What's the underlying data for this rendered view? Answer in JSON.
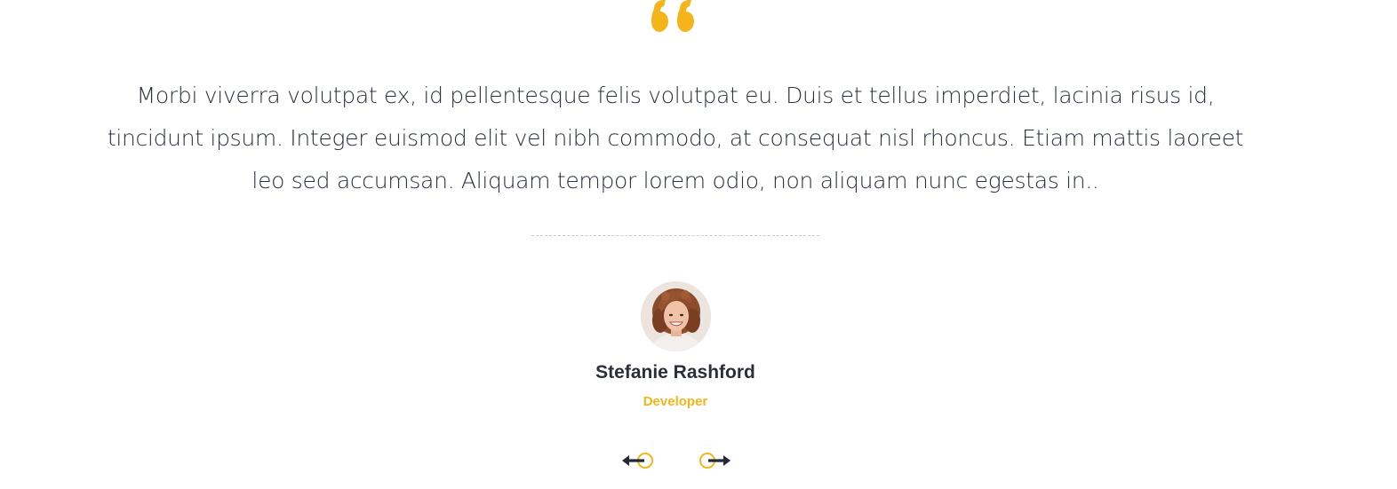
{
  "testimonial": {
    "quote_icon": "quote-open-icon",
    "quote_text": "Morbi viverra volutpat ex, id pellentesque felis volutpat eu. Duis et tellus imperdiet, lacinia risus id, tincidunt ipsum. Integer euismod elit vel nibh commodo, at consequat nisl rhoncus. Etiam mattis laoreet leo sed accumsan. Aliquam tempor lorem odio, non aliquam nunc egestas in..",
    "author": {
      "name": "Stefanie Rashford",
      "role": "Developer",
      "avatar_icon": "avatar-photo"
    }
  },
  "navigation": {
    "prev_icon": "arrow-left-icon",
    "next_icon": "arrow-right-icon"
  },
  "colors": {
    "accent": "#f5b51a",
    "text": "#2a3140",
    "heading": "#2a2f3b",
    "arrow": "#232a36",
    "divider": "#c9c9c9"
  }
}
